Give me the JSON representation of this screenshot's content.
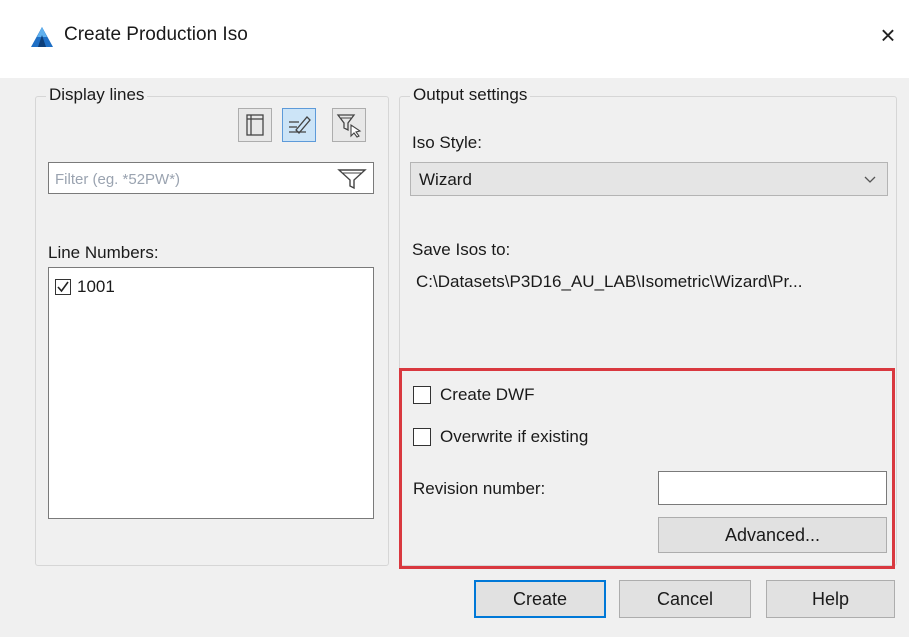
{
  "window": {
    "title": "Create Production Iso",
    "close_glyph": "×",
    "app_icon": "autocad-plant-icon"
  },
  "display_lines": {
    "label": "Display lines",
    "toolbar": [
      {
        "icon": "select-lines-icon"
      },
      {
        "icon": "edit-pencil-icon",
        "active": true
      },
      {
        "icon": "filter-cursor-icon"
      }
    ],
    "filter": {
      "placeholder": "Filter (eg. *52PW*)",
      "value": "",
      "icon": "funnel-icon"
    },
    "line_numbers_label": "Line Numbers:",
    "line_numbers": [
      {
        "label": "1001",
        "checked": true
      }
    ]
  },
  "output_settings": {
    "label": "Output settings",
    "iso_style_label": "Iso Style:",
    "iso_style_value": "Wizard",
    "save_label": "Save Isos to:",
    "save_path": "C:\\Datasets\\P3D16_AU_LAB\\Isometric\\Wizard\\Pr...",
    "create_dwf_label": "Create DWF",
    "create_dwf_checked": false,
    "overwrite_label": "Overwrite if existing",
    "overwrite_checked": false,
    "revision_label": "Revision number:",
    "revision_value": "",
    "advanced_label": "Advanced..."
  },
  "footer": {
    "create_label": "Create",
    "cancel_label": "Cancel",
    "help_label": "Help"
  },
  "colors": {
    "highlight": "#d9383f",
    "accent": "#0078d7"
  }
}
